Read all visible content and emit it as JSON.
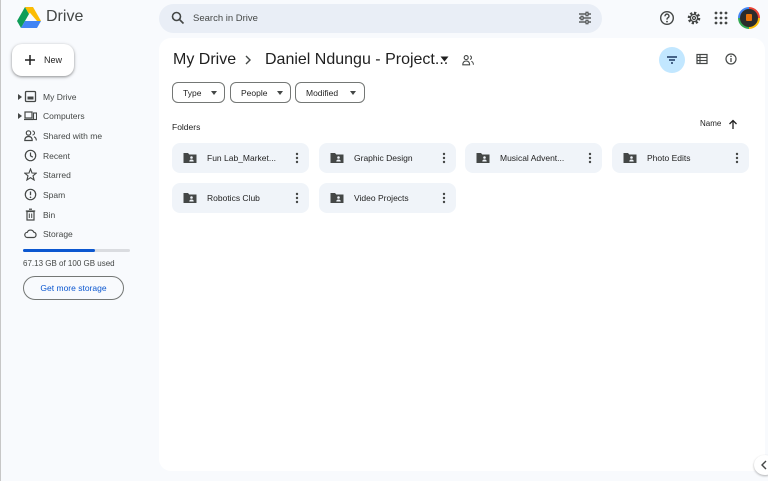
{
  "header": {
    "app_name": "Drive",
    "search_placeholder": "Search in Drive"
  },
  "sidebar": {
    "new_label": "New",
    "items": [
      {
        "label": "My Drive",
        "icon": "my-drive-icon"
      },
      {
        "label": "Computers",
        "icon": "computers-icon"
      },
      {
        "label": "Shared with me",
        "icon": "shared-icon"
      },
      {
        "label": "Recent",
        "icon": "clock-icon"
      },
      {
        "label": "Starred",
        "icon": "star-icon"
      },
      {
        "label": "Spam",
        "icon": "spam-icon"
      },
      {
        "label": "Bin",
        "icon": "bin-icon"
      },
      {
        "label": "Storage",
        "icon": "cloud-icon"
      }
    ],
    "storage_used_fraction": 0.6713,
    "storage_text": "67.13 GB of 100 GB used",
    "get_storage_label": "Get more storage"
  },
  "main": {
    "breadcrumb_root": "My Drive",
    "breadcrumb_current": "Daniel Ndungu - Project...",
    "filters": [
      {
        "label": "Type"
      },
      {
        "label": "People"
      },
      {
        "label": "Modified"
      }
    ],
    "section_label": "Folders",
    "sort_label": "Name",
    "folders": [
      {
        "name": "Fun Lab_Market..."
      },
      {
        "name": "Graphic Design"
      },
      {
        "name": "Musical Advent..."
      },
      {
        "name": "Photo Edits"
      },
      {
        "name": "Robotics Club"
      },
      {
        "name": "Video Projects"
      }
    ]
  },
  "colors": {
    "accent": "#0b57d0",
    "active_toggle": "#c2e7ff",
    "folder_bg": "#f0f4f9",
    "page_bg": "#f8fafd"
  }
}
